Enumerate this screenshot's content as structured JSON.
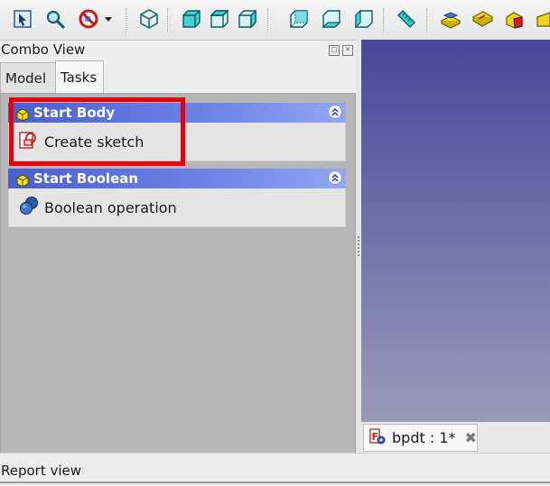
{
  "toolbar": {
    "items": [
      {
        "name": "select-filter-icon"
      },
      {
        "name": "zoom-icon"
      },
      {
        "name": "draw-style-icon"
      },
      {
        "name": "dropdown-arrow-icon"
      },
      {
        "name": "isometric-view-icon"
      },
      {
        "name": "front-view-icon"
      },
      {
        "name": "top-view-icon"
      },
      {
        "name": "right-view-icon"
      },
      {
        "name": "rear-view-icon"
      },
      {
        "name": "bottom-view-icon"
      },
      {
        "name": "left-view-icon"
      },
      {
        "name": "measure-icon"
      },
      {
        "name": "part-icon"
      },
      {
        "name": "group-icon"
      },
      {
        "name": "body-icon"
      }
    ]
  },
  "combo_view": {
    "title": "Combo View",
    "tabs": [
      {
        "label": "Model",
        "active": false
      },
      {
        "label": "Tasks",
        "active": true
      }
    ],
    "groups": [
      {
        "header": "Start Body",
        "items": [
          {
            "label": "Create sketch",
            "icon": "create-sketch-icon"
          }
        ]
      },
      {
        "header": "Start Boolean",
        "items": [
          {
            "label": "Boolean operation",
            "icon": "boolean-icon"
          }
        ]
      }
    ]
  },
  "document": {
    "tab_label": "bpdt : 1*"
  },
  "report_view": {
    "title": "Report view"
  },
  "colors": {
    "group_header_start": "#4a5fd0",
    "group_header_end": "#93a6f2",
    "highlight": "#e8000d",
    "view_top": "#45489a",
    "view_bottom": "#9a9bb8"
  }
}
